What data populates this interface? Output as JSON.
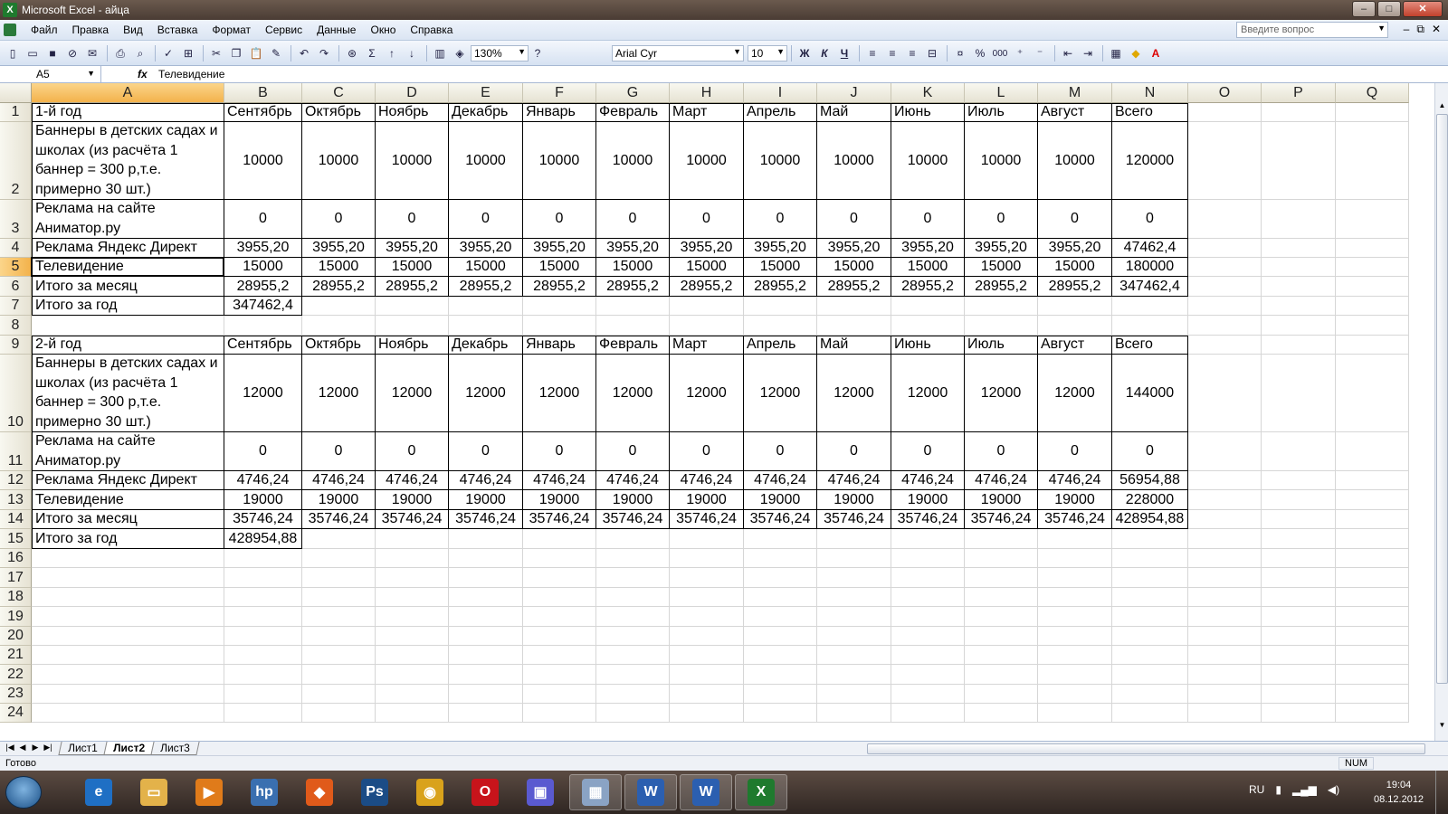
{
  "window": {
    "app_icon": "excel-icon",
    "title": "Microsoft Excel - айца",
    "minimize": "–",
    "maximize": "□",
    "close": "✕"
  },
  "menu": {
    "items": [
      "Файл",
      "Правка",
      "Вид",
      "Вставка",
      "Формат",
      "Сервис",
      "Данные",
      "Окно",
      "Справка"
    ],
    "help_placeholder": "Введите вопрос",
    "mdi_buttons": [
      "–",
      "⧉",
      "✕"
    ]
  },
  "toolbar": {
    "zoom": "130%",
    "font_name": "Arial Cyr",
    "font_size": "10",
    "bold": "Ж",
    "italic": "К",
    "underline": "Ч",
    "sum": "Σ",
    "percent": "%",
    "thousands": "000"
  },
  "formula_bar": {
    "cell_ref": "A5",
    "fx": "fx",
    "content": "Телевидение"
  },
  "sheet": {
    "columns": [
      "A",
      "B",
      "C",
      "D",
      "E",
      "F",
      "G",
      "H",
      "I",
      "J",
      "K",
      "L",
      "M",
      "N",
      "O",
      "P",
      "Q"
    ],
    "row_numbers": [
      "1",
      "2",
      "3",
      "4",
      "5",
      "6",
      "7",
      "8",
      "9",
      "10",
      "11",
      "12",
      "13",
      "14",
      "15",
      "16",
      "17",
      "18",
      "19",
      "20",
      "21",
      "22",
      "23",
      "24"
    ],
    "rows": {
      "r1": [
        "1-й год",
        "Сентябрь",
        "Октябрь",
        "Ноябрь",
        "Декабрь",
        "Январь",
        "Февраль",
        "Март",
        "Апрель",
        "Май",
        "Июнь",
        "Июль",
        "Август",
        "Всего"
      ],
      "r2": [
        "Баннеры в детских садах и школах (из расчёта 1 баннер = 300 р,т.е. примерно 30 шт.)",
        "10000",
        "10000",
        "10000",
        "10000",
        "10000",
        "10000",
        "10000",
        "10000",
        "10000",
        "10000",
        "10000",
        "10000",
        "120000"
      ],
      "r3": [
        "Реклама на сайте Аниматор.ру",
        "0",
        "0",
        "0",
        "0",
        "0",
        "0",
        "0",
        "0",
        "0",
        "0",
        "0",
        "0",
        "0"
      ],
      "r4": [
        "Реклама Яндекс Директ",
        "3955,20",
        "3955,20",
        "3955,20",
        "3955,20",
        "3955,20",
        "3955,20",
        "3955,20",
        "3955,20",
        "3955,20",
        "3955,20",
        "3955,20",
        "3955,20",
        "47462,4"
      ],
      "r5": [
        "Телевидение",
        "15000",
        "15000",
        "15000",
        "15000",
        "15000",
        "15000",
        "15000",
        "15000",
        "15000",
        "15000",
        "15000",
        "15000",
        "180000"
      ],
      "r6": [
        "Итого за месяц",
        "28955,2",
        "28955,2",
        "28955,2",
        "28955,2",
        "28955,2",
        "28955,2",
        "28955,2",
        "28955,2",
        "28955,2",
        "28955,2",
        "28955,2",
        "28955,2",
        "347462,4"
      ],
      "r7": [
        "Итого за год",
        "347462,4"
      ],
      "r9": [
        "2-й год",
        "Сентябрь",
        "Октябрь",
        "Ноябрь",
        "Декабрь",
        "Январь",
        "Февраль",
        "Март",
        "Апрель",
        "Май",
        "Июнь",
        "Июль",
        "Август",
        "Всего"
      ],
      "r10": [
        "Баннеры в детских садах и школах (из расчёта 1 баннер = 300 р,т.е. примерно 30 шт.)",
        "12000",
        "12000",
        "12000",
        "12000",
        "12000",
        "12000",
        "12000",
        "12000",
        "12000",
        "12000",
        "12000",
        "12000",
        "144000"
      ],
      "r11": [
        "Реклама на сайте Аниматор.ру",
        "0",
        "0",
        "0",
        "0",
        "0",
        "0",
        "0",
        "0",
        "0",
        "0",
        "0",
        "0",
        "0"
      ],
      "r12": [
        "Реклама Яндекс Директ",
        "4746,24",
        "4746,24",
        "4746,24",
        "4746,24",
        "4746,24",
        "4746,24",
        "4746,24",
        "4746,24",
        "4746,24",
        "4746,24",
        "4746,24",
        "4746,24",
        "56954,88"
      ],
      "r13": [
        "Телевидение",
        "19000",
        "19000",
        "19000",
        "19000",
        "19000",
        "19000",
        "19000",
        "19000",
        "19000",
        "19000",
        "19000",
        "19000",
        "228000"
      ],
      "r14": [
        "Итого за месяц",
        "35746,24",
        "35746,24",
        "35746,24",
        "35746,24",
        "35746,24",
        "35746,24",
        "35746,24",
        "35746,24",
        "35746,24",
        "35746,24",
        "35746,24",
        "35746,24",
        "428954,88"
      ],
      "r15": [
        "Итого за год",
        "428954,88"
      ]
    }
  },
  "sheet_tabs": [
    "Лист1",
    "Лист2",
    "Лист3"
  ],
  "active_sheet": "Лист2",
  "status": {
    "text": "Готово",
    "num": "NUM"
  },
  "taskbar": {
    "apps": [
      "ie-icon",
      "explorer-icon",
      "media-player-icon",
      "hp-icon",
      "office-icon",
      "photoshop-icon",
      "chrome-icon",
      "opera-icon",
      "save-icon",
      "calculator-icon",
      "word-icon",
      "word-icon",
      "excel-icon"
    ],
    "lang": "RU",
    "time": "19:04",
    "date": "08.12.2012"
  }
}
